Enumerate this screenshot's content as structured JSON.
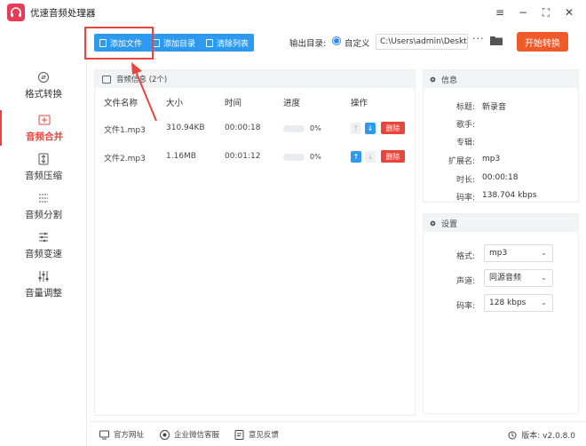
{
  "app": {
    "title": "优速音频处理器"
  },
  "window_controls": {
    "menu": "≡",
    "minimize": "−",
    "maximize": "⛶",
    "close": "✕"
  },
  "sidebar": {
    "items": [
      {
        "label": "格式转换",
        "icon": "format-convert-icon",
        "active": false
      },
      {
        "label": "音频合并",
        "icon": "merge-icon",
        "active": true
      },
      {
        "label": "音频压缩",
        "icon": "compress-icon",
        "active": false
      },
      {
        "label": "音频分割",
        "icon": "split-icon",
        "active": false
      },
      {
        "label": "音频变速",
        "icon": "speed-icon",
        "active": false
      },
      {
        "label": "音量调整",
        "icon": "volume-icon",
        "active": false
      }
    ]
  },
  "toolbar": {
    "add_file": "添加文件",
    "add_folder": "添加目录",
    "clear_list": "清除列表",
    "output_label": "输出目录:",
    "radio_label": "自定义",
    "output_path": "C:\\Users\\admin\\Deskto",
    "more": "···",
    "start": "开始转换"
  },
  "file_list": {
    "header": "音频信息 (2个)",
    "columns": [
      "文件名称",
      "大小",
      "时间",
      "进度",
      "操作"
    ],
    "rows": [
      {
        "name": "文件1.mp3",
        "size": "310.94KB",
        "time": "00:00:18",
        "progress": 0,
        "progress_text": "0%",
        "up_enabled": false,
        "down_enabled": true,
        "delete": "删除"
      },
      {
        "name": "文件2.mp3",
        "size": "1.16MB",
        "time": "00:01:12",
        "progress": 0,
        "progress_text": "0%",
        "up_enabled": true,
        "down_enabled": false,
        "delete": "删除"
      }
    ]
  },
  "info_panel": {
    "title": "信息",
    "fields": [
      {
        "key": "标题:",
        "value": "新录音"
      },
      {
        "key": "歌手:",
        "value": ""
      },
      {
        "key": "专辑:",
        "value": ""
      },
      {
        "key": "扩展名:",
        "value": "mp3"
      },
      {
        "key": "时长:",
        "value": "00:00:18"
      },
      {
        "key": "码率:",
        "value": "138.704 kbps"
      }
    ]
  },
  "settings_panel": {
    "title": "设置",
    "fields": [
      {
        "key": "格式:",
        "value": "mp3"
      },
      {
        "key": "声道:",
        "value": "同源音频"
      },
      {
        "key": "码率:",
        "value": "128 kbps"
      }
    ]
  },
  "footer": {
    "website": "官方网址",
    "wechat": "企业微信客服",
    "feedback": "意见反馈",
    "version": "版本: v2.0.8.0"
  },
  "colors": {
    "accent_blue": "#2d9af0",
    "start_orange": "#f05a28",
    "delete_red": "#e8453c",
    "active_red": "#e8453c"
  }
}
